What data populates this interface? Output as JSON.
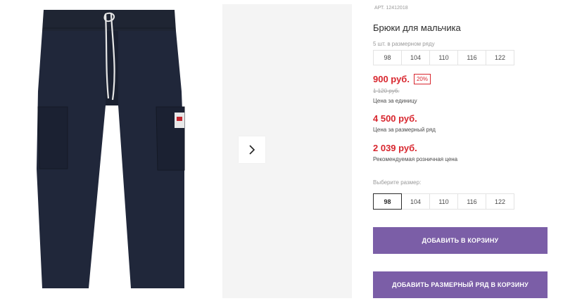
{
  "product": {
    "sku_label": "АРТ.",
    "sku": "12412018",
    "title": "Брюки для мальчика"
  },
  "pack": {
    "label": "5 шт. в размерном ряду",
    "sizes": [
      "98",
      "104",
      "110",
      "116",
      "122"
    ]
  },
  "pricing": {
    "price": "900 руб.",
    "discount": "20%",
    "old_price": "1 120 руб.",
    "unit_caption": "Цена за единицу",
    "pack_price": "4 500 руб.",
    "pack_caption": "Цена за размерный ряд",
    "rrp": "2 039 руб.",
    "rrp_caption": "Рекомендуемая розничная цена"
  },
  "size_select": {
    "label": "Выберите размер:",
    "sizes": [
      "98",
      "104",
      "110",
      "116",
      "122"
    ],
    "selected": "98"
  },
  "buttons": {
    "add_to_cart": "ДОБАВИТЬ В КОРЗИНУ",
    "add_pack_to_cart": "ДОБАВИТЬ РАЗМЕРНЫЙ РЯД В КОРЗИНУ"
  },
  "colors": {
    "accent": "#7b5ea7",
    "price_red": "#d8262e",
    "product_navy": "#1f2533"
  },
  "gallery": {
    "next_icon": "chevron-right-icon"
  }
}
